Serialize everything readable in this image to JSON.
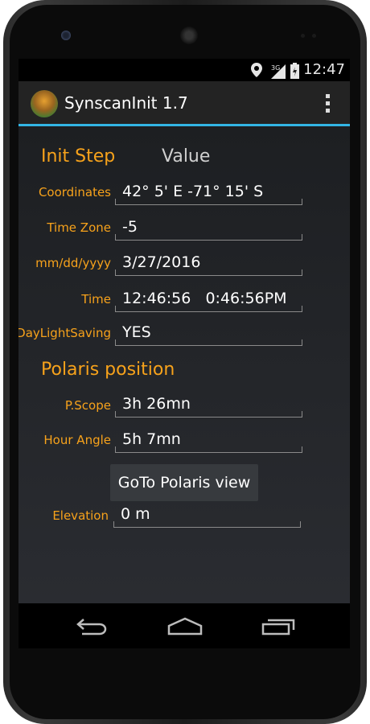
{
  "status": {
    "time": "12:47",
    "network": "3G"
  },
  "app": {
    "title": "SynscanInit 1.7"
  },
  "init": {
    "step_header": "Init Step",
    "value_header": "Value",
    "rows": [
      {
        "label": "Coordinates",
        "value": "42° 5' E  -71° 15' S"
      },
      {
        "label": "Time Zone",
        "value": "-5"
      },
      {
        "label": "mm/dd/yyyy",
        "value": "3/27/2016"
      },
      {
        "label": "Time",
        "value": "12:46:56   0:46:56PM"
      },
      {
        "label": "DayLightSaving",
        "value": "YES"
      }
    ]
  },
  "polaris": {
    "header": "Polaris position",
    "rows": [
      {
        "label": "P.Scope",
        "value": "3h 26mn"
      },
      {
        "label": "Hour Angle",
        "value": "5h 7mn"
      }
    ],
    "goto_button": "GoTo Polaris view",
    "elevation": {
      "label": "Elevation",
      "value": "0 m"
    }
  },
  "colors": {
    "accent": "#f7a21b",
    "holo_blue": "#33b5e5"
  }
}
